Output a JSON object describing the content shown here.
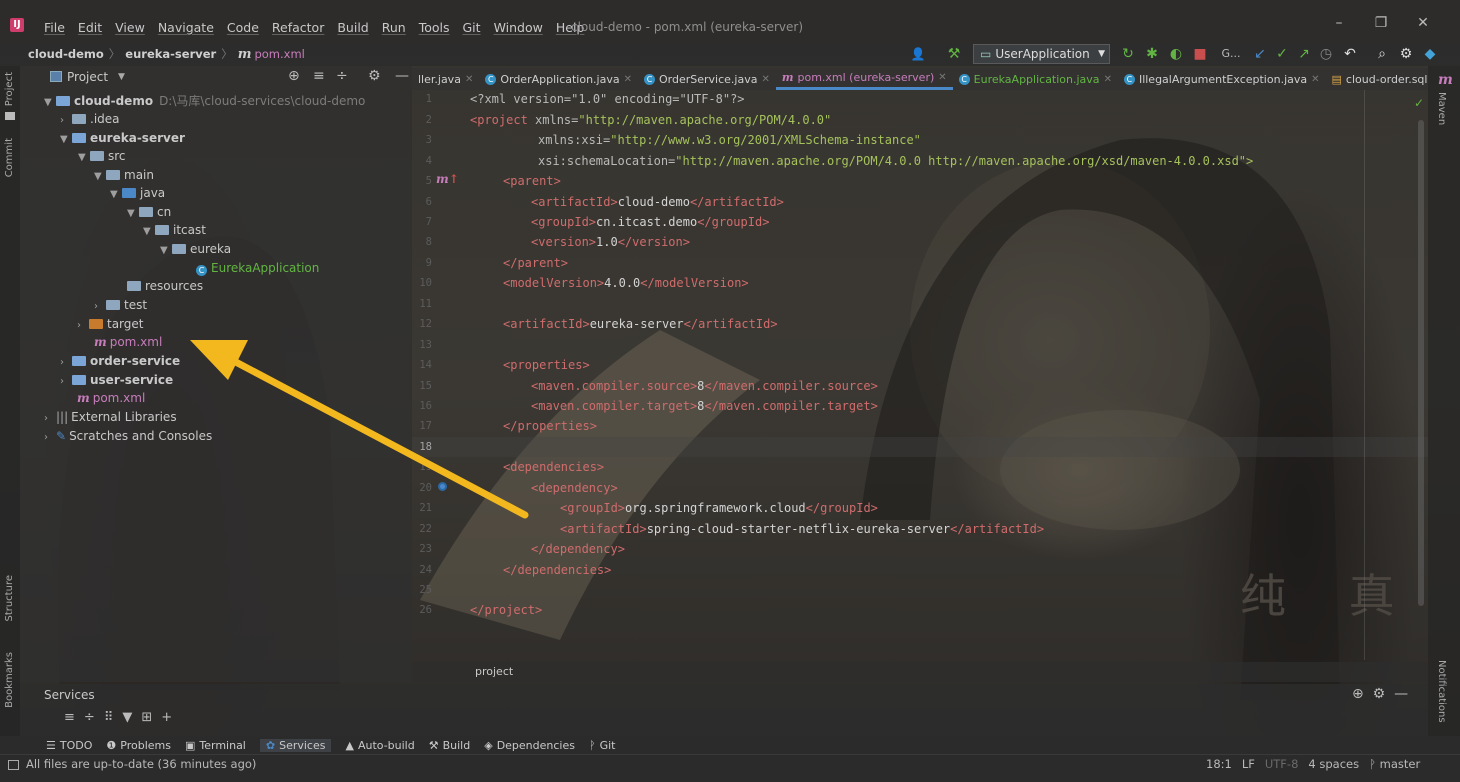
{
  "window": {
    "title": "cloud-demo - pom.xml (eureka-server)",
    "menu": [
      "File",
      "Edit",
      "View",
      "Navigate",
      "Code",
      "Refactor",
      "Build",
      "Run",
      "Tools",
      "Git",
      "Window",
      "Help"
    ]
  },
  "breadcrumb": {
    "project": "cloud-demo",
    "module": "eureka-server",
    "file": "pom.xml"
  },
  "toolbar": {
    "run_config": "UserApplication",
    "git_label": "G..."
  },
  "project_panel": {
    "title": "Project",
    "tree": [
      {
        "label": "cloud-demo",
        "path": "D:\\马库\\cloud-services\\cloud-demo"
      },
      {
        "label": ".idea"
      },
      {
        "label": "eureka-server"
      },
      {
        "label": "src"
      },
      {
        "label": "main"
      },
      {
        "label": "java"
      },
      {
        "label": "cn"
      },
      {
        "label": "itcast"
      },
      {
        "label": "eureka"
      },
      {
        "label": "EurekaApplication"
      },
      {
        "label": "resources"
      },
      {
        "label": "test"
      },
      {
        "label": "target"
      },
      {
        "label": "pom.xml"
      },
      {
        "label": "order-service"
      },
      {
        "label": "user-service"
      },
      {
        "label": "pom.xml"
      },
      {
        "label": "External Libraries"
      },
      {
        "label": "Scratches and Consoles"
      }
    ]
  },
  "tabs": [
    {
      "label": "ller.java"
    },
    {
      "label": "OrderApplication.java"
    },
    {
      "label": "OrderService.java"
    },
    {
      "label": "pom.xml (eureka-server)"
    },
    {
      "label": "EurekaApplication.java"
    },
    {
      "label": "IllegalArgumentException.java"
    },
    {
      "label": "cloud-order.sql"
    },
    {
      "label": "m"
    }
  ],
  "editor": {
    "lines": [
      "1",
      "2",
      "3",
      "4",
      "5",
      "6",
      "7",
      "8",
      "9",
      "10",
      "11",
      "12",
      "13",
      "14",
      "15",
      "16",
      "17",
      "18",
      "19",
      "20",
      "21",
      "22",
      "23",
      "24",
      "25",
      "26"
    ],
    "breadcrumb": "project",
    "code": {
      "l1": "<?xml version=\"1.0\" encoding=\"UTF-8\"?>",
      "l2_tag": "<project",
      "l2_attr": " xmlns=",
      "l2_val": "\"http://maven.apache.org/POM/4.0.0\"",
      "l3_attr": "xmlns:xsi=",
      "l3_val": "\"http://www.w3.org/2001/XMLSchema-instance\"",
      "l4_attr": "xsi:schemaLocation=",
      "l4_val": "\"http://maven.apache.org/POM/4.0.0 http://maven.apache.org/xsd/maven-4.0.0.xsd\">",
      "parent_open": "<parent>",
      "aid_open": "<artifactId>",
      "aid_val": "cloud-demo",
      "aid_close": "</artifactId>",
      "gid_open": "<groupId>",
      "gid_val": "cn.itcast.demo",
      "gid_close": "</groupId>",
      "ver_open": "<version>",
      "ver_val": "1.0",
      "ver_close": "</version>",
      "parent_close": "</parent>",
      "mv_open": "<modelVersion>",
      "mv_val": "4.0.0",
      "mv_close": "</modelVersion>",
      "aid2_val": "eureka-server",
      "props_open": "<properties>",
      "src_open": "<maven.compiler.source>",
      "src_val": "8",
      "src_close": "</maven.compiler.source>",
      "tgt_open": "<maven.compiler.target>",
      "tgt_val": "8",
      "tgt_close": "</maven.compiler.target>",
      "props_close": "</properties>",
      "deps_open": "<dependencies>",
      "dep_open": "<dependency>",
      "gid2_val": "org.springframework.cloud",
      "aid3_val": "spring-cloud-starter-netflix-eureka-server",
      "dep_close": "</dependency>",
      "deps_close": "</dependencies>",
      "proj_close": "</project>"
    }
  },
  "stripes": {
    "project": "Project",
    "commit": "Commit",
    "structure": "Structure",
    "bookmarks": "Bookmarks",
    "maven": "Maven",
    "notifications": "Notifications"
  },
  "services": {
    "title": "Services"
  },
  "bottom_tabs": [
    "TODO",
    "Problems",
    "Terminal",
    "Services",
    "Auto-build",
    "Build",
    "Dependencies",
    "Git"
  ],
  "status": {
    "message": "All files are up-to-date (36 minutes ago)",
    "position": "18:1",
    "line_sep": "LF",
    "encoding": "UTF-8",
    "indent": "4 spaces",
    "branch": "master"
  },
  "background": {
    "chars": "纯 真"
  },
  "colors": {
    "arrow": "#f3b81e",
    "active_tab": "#4a88c7"
  }
}
